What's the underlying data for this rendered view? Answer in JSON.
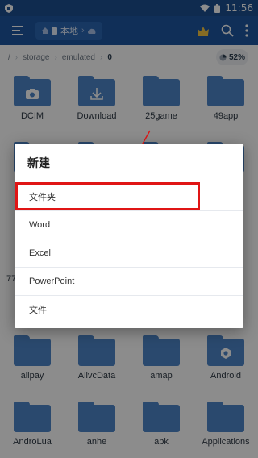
{
  "status": {
    "time": "11:56"
  },
  "toolbar": {
    "path_chip_label": "本地"
  },
  "breadcrumb": {
    "root": "/",
    "crumbs": [
      "storage",
      "emulated",
      "0"
    ],
    "storage_percent": "52%"
  },
  "grid": {
    "items": [
      {
        "label": "DCIM",
        "icon": "camera-icon"
      },
      {
        "label": "Download",
        "icon": "download-icon"
      },
      {
        "label": "25game",
        "icon": "folder-icon"
      },
      {
        "label": "49app",
        "icon": "folder-icon"
      },
      {
        "label": "alipay",
        "icon": "folder-icon"
      },
      {
        "label": "AlivcData",
        "icon": "folder-icon"
      },
      {
        "label": "amap",
        "icon": "folder-icon"
      },
      {
        "label": "Android",
        "icon": "gear-icon"
      },
      {
        "label": "AndroLua",
        "icon": "folder-icon"
      },
      {
        "label": "anhe",
        "icon": "folder-icon"
      },
      {
        "label": "apk",
        "icon": "folder-icon"
      },
      {
        "label": "Applications",
        "icon": "folder-icon"
      }
    ],
    "partial_label": "77"
  },
  "dialog": {
    "title": "新建",
    "options": [
      {
        "label": "文件夹"
      },
      {
        "label": "Word"
      },
      {
        "label": "Excel"
      },
      {
        "label": "PowerPoint"
      },
      {
        "label": "文件"
      }
    ]
  },
  "colors": {
    "toolbar": "#1e56a0",
    "status_bar": "#1c4f90",
    "folder": "#4e86c8",
    "highlight": "#e01515"
  }
}
